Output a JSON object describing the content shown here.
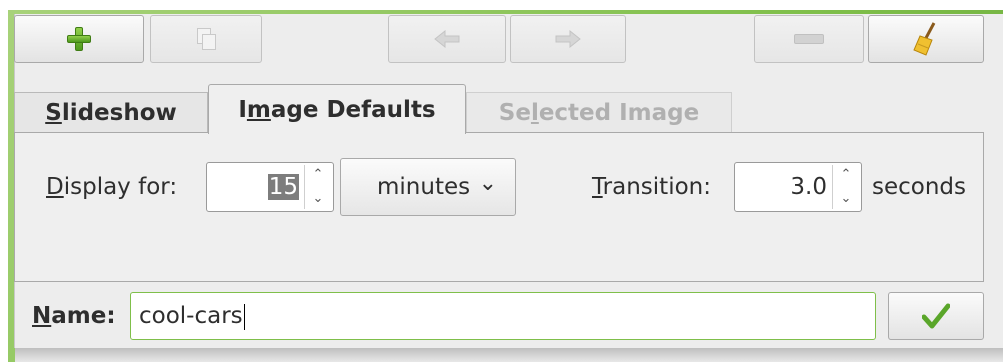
{
  "toolbar": {
    "add_icon": "green-plus-icon",
    "duplicate_icon": "copy-icon",
    "prev_icon": "left-arrow-icon",
    "next_icon": "right-arrow-icon",
    "remove_icon": "minus-icon",
    "clear_icon": "broom-icon"
  },
  "tabs": [
    {
      "label": "Slideshow",
      "mnemonic": "S"
    },
    {
      "label": "Image Defaults",
      "mnemonic": "m"
    },
    {
      "label": "Selected Image",
      "mnemonic": "l"
    }
  ],
  "defaults": {
    "display_label": "Display for:",
    "display_value": "15",
    "display_unit": "minutes",
    "transition_label": "Transition:",
    "transition_value": "3.0",
    "transition_unit": "seconds"
  },
  "name": {
    "label": "Name:",
    "value": "cool-cars"
  },
  "colors": {
    "accent_green": "#7fbf4a"
  }
}
